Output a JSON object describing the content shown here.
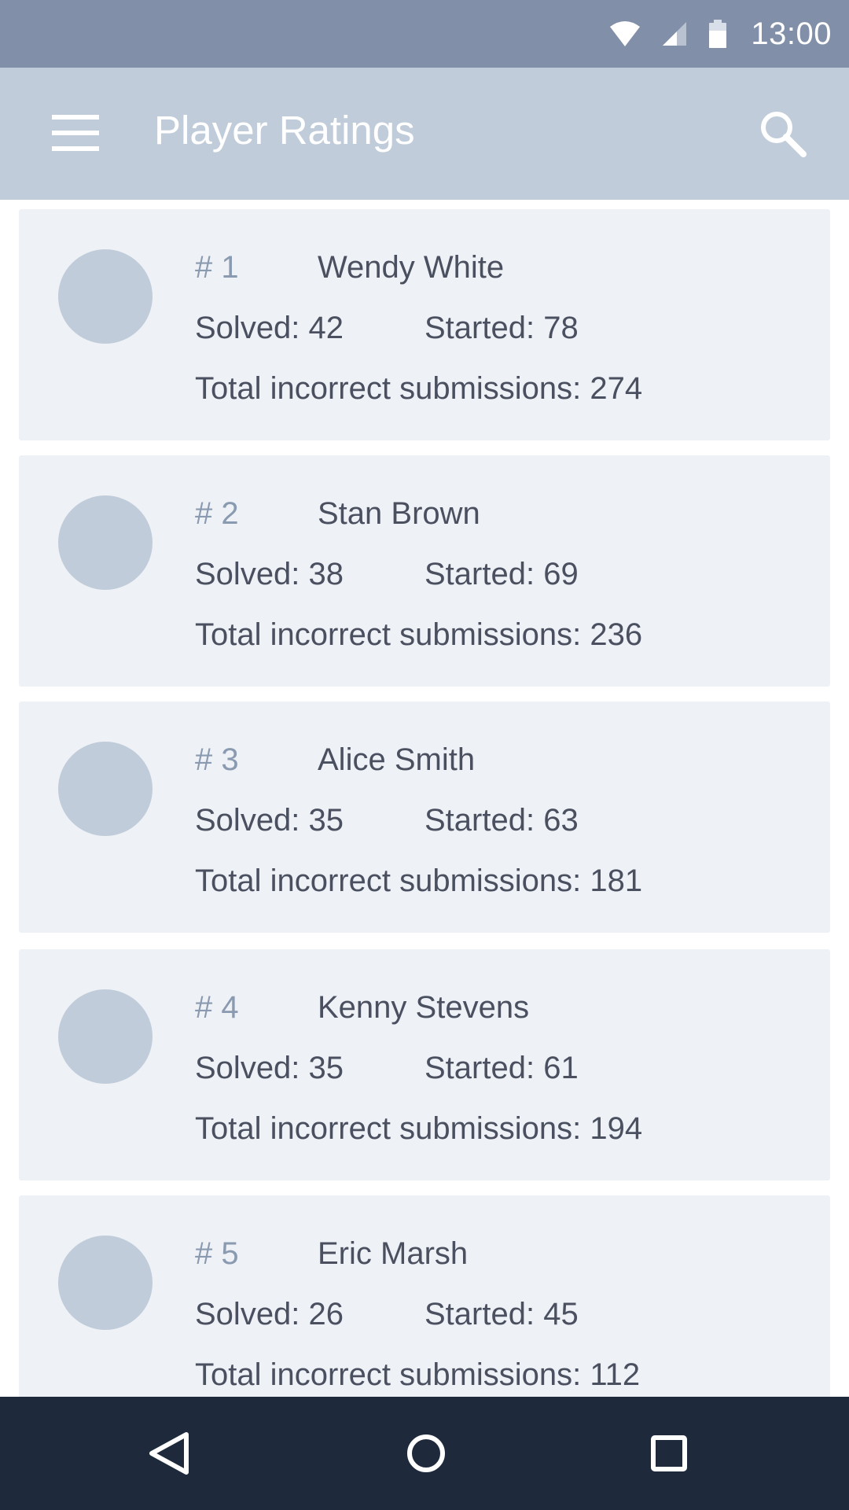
{
  "status_bar": {
    "time": "13:00",
    "icons": [
      "wifi-icon",
      "signal-icon",
      "battery-icon"
    ]
  },
  "app_bar": {
    "title": "Player Ratings",
    "menu_icon": "hamburger-menu-icon",
    "search_icon": "search-icon"
  },
  "players": [
    {
      "rank": "# 1",
      "name": "Wendy White",
      "solved": "Solved: 42",
      "started": "Started: 78",
      "incorrect": "Total incorrect submissions: 274"
    },
    {
      "rank": "# 2",
      "name": "Stan Brown",
      "solved": "Solved: 38",
      "started": "Started: 69",
      "incorrect": "Total incorrect submissions: 236"
    },
    {
      "rank": "# 3",
      "name": "Alice Smith",
      "solved": "Solved: 35",
      "started": "Started: 63",
      "incorrect": "Total incorrect submissions: 181"
    },
    {
      "rank": "# 4",
      "name": "Kenny Stevens",
      "solved": "Solved: 35",
      "started": "Started: 61",
      "incorrect": "Total incorrect submissions: 194"
    },
    {
      "rank": "# 5",
      "name": "Eric Marsh",
      "solved": "Solved: 26",
      "started": "Started: 45",
      "incorrect": "Total incorrect submissions: 112"
    }
  ],
  "nav_bar": {
    "icons": [
      "back-icon",
      "home-icon",
      "recents-icon"
    ]
  },
  "colors": {
    "status_bar": "#8190a8",
    "app_bar": "#c0ccda",
    "card": "#eef1f5",
    "avatar": "#c0ccda",
    "nav_bar": "#1e2a3c"
  }
}
